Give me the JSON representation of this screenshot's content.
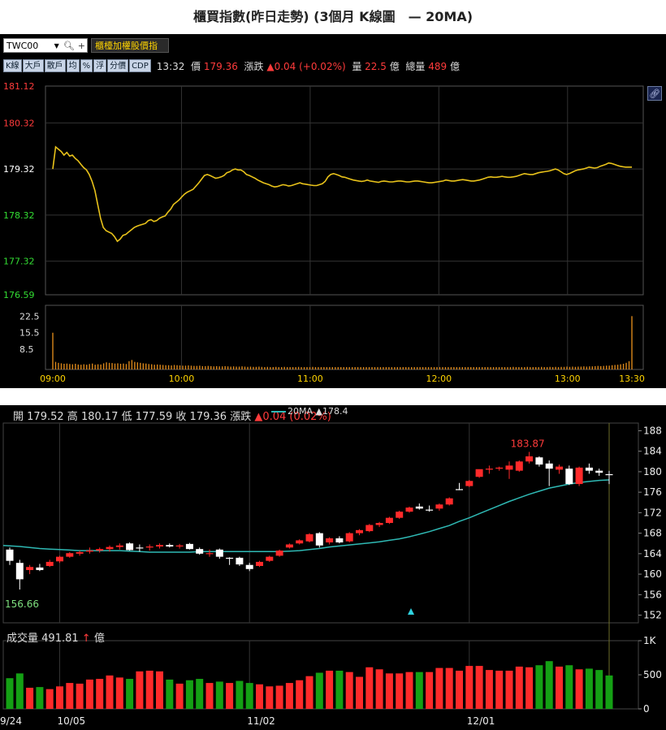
{
  "page_title": "櫃買指數(昨日走勢) (3個月 K線圖　— 20MA)",
  "intraday": {
    "symbol": "TWC00",
    "symbol_name": "櫃檯加權股價指",
    "period_tabs": [
      "K線",
      "大戶",
      "散戶",
      "均",
      "%",
      "浮",
      "分價",
      "CDP"
    ],
    "quote": {
      "time": "13:32",
      "price_label": "價",
      "price": "179.36",
      "change_label": "漲跌",
      "change": "▲0.04 (+0.02%)",
      "volume_label": "量",
      "volume": "22.5",
      "volume_unit": "億",
      "total_label": "總量",
      "total": "489",
      "total_unit": "億"
    }
  },
  "daily": {
    "ohlc": {
      "open_label": "開",
      "open": "179.52",
      "high_label": "高",
      "high": "180.17",
      "low_label": "低",
      "low": "177.59",
      "close_label": "收",
      "close": "179.36",
      "change_label": "漲跌",
      "change": "▲0.04 (0.02%)"
    },
    "ma_label": "20MA",
    "ma_value": "▲178.4",
    "volume_label": "成交量",
    "volume_value": "491.81",
    "volume_arrow": "↑",
    "volume_unit": "億"
  },
  "colors": {
    "price_line": "#e8c21a",
    "up": "#ff2a2a",
    "down": "#14a014",
    "ma": "#2fb9b4",
    "flat": "#ffffff"
  },
  "chart_data": [
    {
      "type": "line",
      "title": "",
      "x_ticks": [
        "09:00",
        "10:00",
        "11:00",
        "12:00",
        "13:00",
        "13:30"
      ],
      "y_ticks": [
        "181.12",
        "180.32",
        "179.32",
        "178.32",
        "177.32",
        "176.59"
      ],
      "ylim": [
        176.59,
        181.12
      ],
      "reference": 179.32,
      "series": [
        {
          "values": [
            179.32,
            179.8,
            179.75,
            179.7,
            179.62,
            179.68,
            179.6,
            179.62,
            179.55,
            179.5,
            179.42,
            179.35,
            179.3,
            179.2,
            179.05,
            178.85,
            178.55,
            178.25,
            178.05,
            177.98,
            177.95,
            177.92,
            177.85,
            177.75,
            177.8,
            177.88,
            177.9,
            177.95,
            178.0,
            178.05,
            178.08,
            178.1,
            178.12,
            178.14,
            178.2,
            178.22,
            178.18,
            178.2,
            178.25,
            178.28,
            178.3,
            178.38,
            178.45,
            178.55,
            178.6,
            178.65,
            178.72,
            178.78,
            178.82,
            178.85,
            178.88,
            178.95,
            179.02,
            179.1,
            179.18,
            179.2,
            179.18,
            179.15,
            179.12,
            179.13,
            179.15,
            179.18,
            179.24,
            179.26,
            179.3,
            179.32,
            179.3,
            179.3,
            179.26,
            179.2,
            179.18,
            179.15,
            179.12,
            179.08,
            179.05,
            179.02,
            179.0,
            178.98,
            178.95,
            178.93,
            178.94,
            178.96,
            178.98,
            178.97,
            178.95,
            178.96,
            178.98,
            179.0,
            179.02,
            179.0,
            178.99,
            178.98,
            178.97,
            178.96,
            178.96,
            178.98,
            179.0,
            179.05,
            179.15,
            179.2,
            179.22,
            179.2,
            179.18,
            179.15,
            179.14,
            179.12,
            179.1,
            179.08,
            179.07,
            179.06,
            179.05,
            179.06,
            179.08,
            179.06,
            179.05,
            179.04,
            179.03,
            179.05,
            179.06,
            179.05,
            179.04,
            179.04,
            179.05,
            179.06,
            179.06,
            179.05,
            179.04,
            179.04,
            179.05,
            179.06,
            179.06,
            179.05,
            179.04,
            179.03,
            179.02,
            179.02,
            179.03,
            179.04,
            179.05,
            179.06,
            179.08,
            179.07,
            179.06,
            179.06,
            179.07,
            179.08,
            179.09,
            179.08,
            179.07,
            179.06,
            179.06,
            179.07,
            179.08,
            179.1,
            179.12,
            179.14,
            179.15,
            179.14,
            179.14,
            179.15,
            179.16,
            179.15,
            179.14,
            179.14,
            179.15,
            179.16,
            179.18,
            179.2,
            179.22,
            179.21,
            179.2,
            179.2,
            179.22,
            179.24,
            179.25,
            179.26,
            179.27,
            179.28,
            179.3,
            179.32,
            179.3,
            179.26,
            179.22,
            179.2,
            179.22,
            179.25,
            179.28,
            179.3,
            179.31,
            179.32,
            179.34,
            179.36,
            179.35,
            179.34,
            179.35,
            179.38,
            179.4,
            179.42,
            179.45,
            179.44,
            179.42,
            179.4,
            179.38,
            179.37,
            179.36,
            179.36,
            179.36,
            179.36,
            179.36
          ]
        }
      ]
    },
    {
      "type": "bar",
      "title": "",
      "y_ticks": [
        "22.5",
        "15.5",
        "8.5"
      ],
      "ylim": [
        0,
        25
      ],
      "values": [
        15.5,
        3.2,
        2.8,
        2.6,
        2.4,
        2.5,
        2.3,
        2.2,
        2.4,
        2.1,
        2.0,
        2.2,
        2.0,
        2.3,
        2.5,
        2.0,
        2.2,
        2.1,
        2.6,
        3.0,
        2.8,
        2.7,
        2.5,
        2.6,
        2.4,
        2.5,
        2.3,
        3.5,
        4.0,
        3.2,
        3.0,
        2.8,
        2.6,
        2.5,
        2.3,
        2.2,
        2.0,
        2.1,
        2.0,
        1.9,
        1.8,
        1.8,
        1.7,
        1.9,
        1.8,
        1.7,
        1.6,
        1.6,
        1.7,
        1.6,
        1.5,
        1.5,
        1.6,
        1.4,
        1.4,
        1.5,
        1.4,
        1.3,
        1.4,
        1.3,
        1.3,
        1.4,
        1.3,
        1.2,
        1.3,
        1.2,
        1.2,
        1.3,
        1.2,
        1.1,
        1.2,
        1.1,
        1.1,
        1.2,
        1.1,
        1.0,
        1.1,
        1.0,
        1.0,
        1.1,
        1.0,
        1.0,
        1.1,
        1.0,
        1.0,
        1.0,
        1.0,
        1.1,
        1.0,
        1.0,
        1.0,
        1.0,
        1.1,
        1.0,
        1.0,
        1.0,
        1.0,
        1.0,
        1.0,
        1.0,
        1.0,
        1.0,
        1.0,
        1.0,
        1.0,
        1.0,
        1.0,
        1.0,
        1.0,
        1.0,
        1.0,
        1.0,
        1.0,
        1.0,
        1.0,
        1.0,
        1.0,
        1.0,
        1.0,
        1.0,
        1.0,
        1.0,
        1.0,
        1.0,
        1.0,
        1.0,
        1.0,
        1.0,
        1.0,
        1.0,
        1.0,
        1.0,
        1.0,
        1.0,
        1.0,
        1.0,
        1.0,
        1.0,
        1.0,
        1.0,
        1.0,
        1.0,
        1.0,
        1.0,
        1.0,
        1.0,
        1.0,
        1.0,
        1.0,
        1.0,
        1.0,
        1.0,
        1.0,
        1.0,
        1.0,
        1.0,
        1.0,
        1.0,
        1.0,
        1.0,
        1.0,
        1.0,
        1.0,
        1.1,
        1.0,
        1.0,
        1.0,
        1.0,
        1.1,
        1.0,
        1.0,
        1.0,
        1.0,
        1.1,
        1.0,
        1.0,
        1.1,
        1.0,
        1.1,
        1.0,
        1.1,
        1.1,
        1.2,
        1.1,
        1.2,
        1.1,
        1.2,
        1.2,
        1.3,
        1.2,
        1.3,
        1.3,
        1.4,
        1.5,
        1.4,
        1.5,
        1.6,
        1.6,
        1.8,
        1.9,
        2.0,
        2.2,
        2.4,
        2.8,
        3.5,
        22.5
      ]
    },
    {
      "type": "candlestick",
      "title": "",
      "x_ticks": [
        "9/24",
        "10/05",
        "11/02",
        "12/01"
      ],
      "y_ticks": [
        "188",
        "184",
        "180",
        "176",
        "172",
        "168",
        "164",
        "160",
        "156",
        "152"
      ],
      "ylim": [
        150.5,
        189.5
      ],
      "annotations": [
        "183.87",
        "156.66"
      ],
      "candles": [
        {
          "o": 164.8,
          "h": 165.2,
          "l": 161.8,
          "c": 162.6
        },
        {
          "o": 162.2,
          "h": 162.8,
          "l": 157.0,
          "c": 159.0
        },
        {
          "o": 160.8,
          "h": 161.8,
          "l": 160.0,
          "c": 161.4
        },
        {
          "o": 161.3,
          "h": 162.0,
          "l": 160.6,
          "c": 160.8
        },
        {
          "o": 161.6,
          "h": 162.8,
          "l": 161.4,
          "c": 162.4
        },
        {
          "o": 162.5,
          "h": 163.6,
          "l": 162.2,
          "c": 163.4
        },
        {
          "o": 163.4,
          "h": 164.3,
          "l": 163.2,
          "c": 164.1
        },
        {
          "o": 164.0,
          "h": 164.6,
          "l": 163.6,
          "c": 164.3
        },
        {
          "o": 164.4,
          "h": 165.2,
          "l": 164.0,
          "c": 164.6
        },
        {
          "o": 164.6,
          "h": 165.2,
          "l": 164.2,
          "c": 164.9
        },
        {
          "o": 164.9,
          "h": 165.6,
          "l": 164.4,
          "c": 165.3
        },
        {
          "o": 165.3,
          "h": 166.0,
          "l": 164.8,
          "c": 165.6
        },
        {
          "o": 166.0,
          "h": 166.2,
          "l": 164.6,
          "c": 164.7
        },
        {
          "o": 165.2,
          "h": 165.8,
          "l": 164.4,
          "c": 165.2
        },
        {
          "o": 165.2,
          "h": 165.8,
          "l": 164.6,
          "c": 165.4
        },
        {
          "o": 165.4,
          "h": 166.0,
          "l": 165.0,
          "c": 165.7
        },
        {
          "o": 165.7,
          "h": 166.0,
          "l": 165.2,
          "c": 165.4
        },
        {
          "o": 165.4,
          "h": 165.9,
          "l": 165.0,
          "c": 165.6
        },
        {
          "o": 165.9,
          "h": 166.1,
          "l": 164.8,
          "c": 164.9
        },
        {
          "o": 164.9,
          "h": 165.2,
          "l": 163.8,
          "c": 164.0
        },
        {
          "o": 164.0,
          "h": 164.8,
          "l": 163.4,
          "c": 164.1
        },
        {
          "o": 164.8,
          "h": 165.0,
          "l": 163.0,
          "c": 163.4
        },
        {
          "o": 163.2,
          "h": 163.3,
          "l": 161.8,
          "c": 163.2
        },
        {
          "o": 163.2,
          "h": 163.4,
          "l": 161.6,
          "c": 161.9
        },
        {
          "o": 161.8,
          "h": 162.2,
          "l": 160.6,
          "c": 161.0
        },
        {
          "o": 161.6,
          "h": 162.6,
          "l": 161.4,
          "c": 162.4
        },
        {
          "o": 162.6,
          "h": 163.6,
          "l": 162.4,
          "c": 163.4
        },
        {
          "o": 163.6,
          "h": 164.8,
          "l": 163.4,
          "c": 164.6
        },
        {
          "o": 165.2,
          "h": 166.0,
          "l": 165.0,
          "c": 165.8
        },
        {
          "o": 166.0,
          "h": 166.8,
          "l": 165.8,
          "c": 166.6
        },
        {
          "o": 166.4,
          "h": 168.0,
          "l": 166.2,
          "c": 167.8
        },
        {
          "o": 168.0,
          "h": 168.2,
          "l": 165.2,
          "c": 165.6
        },
        {
          "o": 166.2,
          "h": 167.2,
          "l": 165.8,
          "c": 167.0
        },
        {
          "o": 167.0,
          "h": 167.4,
          "l": 166.0,
          "c": 166.2
        },
        {
          "o": 166.4,
          "h": 168.2,
          "l": 166.2,
          "c": 168.0
        },
        {
          "o": 168.0,
          "h": 168.8,
          "l": 167.6,
          "c": 168.6
        },
        {
          "o": 168.4,
          "h": 169.8,
          "l": 168.2,
          "c": 169.6
        },
        {
          "o": 169.6,
          "h": 170.2,
          "l": 169.2,
          "c": 170.0
        },
        {
          "o": 170.0,
          "h": 171.2,
          "l": 169.8,
          "c": 171.0
        },
        {
          "o": 171.0,
          "h": 172.4,
          "l": 170.8,
          "c": 172.2
        },
        {
          "o": 172.2,
          "h": 173.2,
          "l": 172.0,
          "c": 173.0
        },
        {
          "o": 173.2,
          "h": 173.8,
          "l": 172.6,
          "c": 172.8
        },
        {
          "o": 172.6,
          "h": 173.4,
          "l": 172.2,
          "c": 172.6
        },
        {
          "o": 172.8,
          "h": 173.8,
          "l": 172.4,
          "c": 173.6
        },
        {
          "o": 173.6,
          "h": 175.0,
          "l": 173.4,
          "c": 174.8
        },
        {
          "o": 176.6,
          "h": 177.8,
          "l": 176.4,
          "c": 176.6
        },
        {
          "o": 177.2,
          "h": 178.4,
          "l": 177.0,
          "c": 178.2
        },
        {
          "o": 179.0,
          "h": 180.0,
          "l": 178.8,
          "c": 180.5
        },
        {
          "o": 180.4,
          "h": 181.2,
          "l": 179.6,
          "c": 180.6
        },
        {
          "o": 180.6,
          "h": 181.0,
          "l": 180.2,
          "c": 180.8
        },
        {
          "o": 180.4,
          "h": 182.0,
          "l": 178.6,
          "c": 181.2
        },
        {
          "o": 180.2,
          "h": 182.2,
          "l": 180.0,
          "c": 182.0
        },
        {
          "o": 182.0,
          "h": 183.87,
          "l": 181.6,
          "c": 183.0
        },
        {
          "o": 182.8,
          "h": 183.0,
          "l": 181.0,
          "c": 181.4
        },
        {
          "o": 181.6,
          "h": 182.2,
          "l": 177.2,
          "c": 180.6
        },
        {
          "o": 180.4,
          "h": 181.4,
          "l": 179.6,
          "c": 181.0
        },
        {
          "o": 180.6,
          "h": 181.2,
          "l": 177.4,
          "c": 177.6
        },
        {
          "o": 177.6,
          "h": 181.0,
          "l": 177.2,
          "c": 180.8
        },
        {
          "o": 180.8,
          "h": 181.6,
          "l": 179.6,
          "c": 180.2
        },
        {
          "o": 180.2,
          "h": 180.6,
          "l": 179.2,
          "c": 179.8
        },
        {
          "o": 179.52,
          "h": 180.17,
          "l": 177.59,
          "c": 179.36
        }
      ],
      "ma20": [
        165.6,
        165.4,
        165.2,
        165.0,
        164.9,
        164.8,
        164.7,
        164.6,
        164.6,
        164.6,
        164.6,
        164.6,
        164.5,
        164.4,
        164.3,
        164.3,
        164.3,
        164.3,
        164.3,
        164.4,
        164.4,
        164.4,
        164.4,
        164.4,
        164.4,
        164.4,
        164.4,
        164.4,
        164.5,
        164.6,
        164.8,
        165.0,
        165.3,
        165.5,
        165.7,
        165.9,
        166.1,
        166.3,
        166.6,
        166.9,
        167.3,
        167.8,
        168.3,
        168.9,
        169.5,
        170.3,
        171.0,
        171.8,
        172.6,
        173.4,
        174.2,
        174.9,
        175.6,
        176.2,
        176.8,
        177.2,
        177.6,
        177.9,
        178.1,
        178.3,
        178.4
      ]
    },
    {
      "type": "bar",
      "title": "",
      "y_ticks": [
        "1K",
        "500",
        "0"
      ],
      "ylim": [
        0,
        1000
      ],
      "values": [
        450,
        520,
        310,
        320,
        290,
        330,
        380,
        370,
        430,
        440,
        490,
        460,
        440,
        550,
        560,
        550,
        430,
        370,
        420,
        440,
        380,
        400,
        380,
        410,
        380,
        360,
        330,
        340,
        380,
        420,
        480,
        530,
        560,
        560,
        540,
        470,
        610,
        580,
        520,
        520,
        540,
        540,
        540,
        600,
        600,
        560,
        630,
        630,
        570,
        560,
        560,
        620,
        610,
        640,
        700,
        620,
        640,
        580,
        590,
        570,
        490
      ],
      "colors_by_candle": true
    }
  ]
}
